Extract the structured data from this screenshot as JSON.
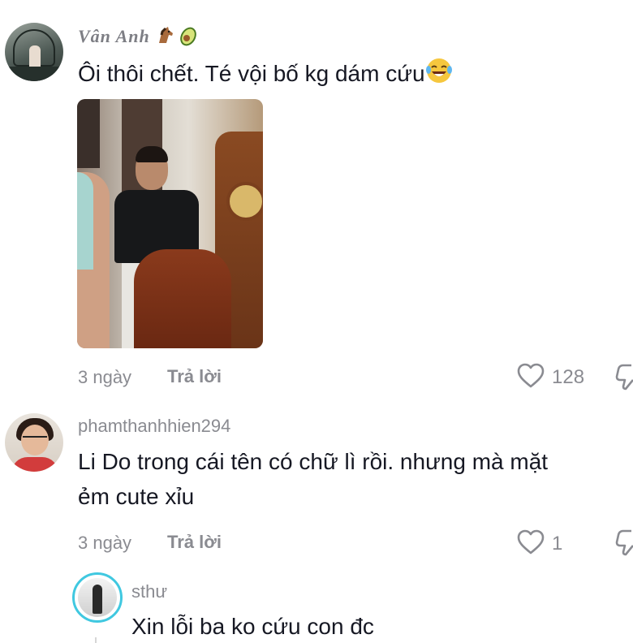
{
  "comments": [
    {
      "username": "Vân Anh",
      "username_emojis": [
        "horse-emoji",
        "avocado-emoji"
      ],
      "text": "Ôi thôi chết. Té vội bố kg dám cứu",
      "text_emoji": "laughing-tears-emoji",
      "has_photo": true,
      "time": "3 ngày",
      "reply_label": "Trả lời",
      "likes": "128"
    },
    {
      "username": "phamthanhhien294",
      "text_line1": "Li Do trong cái tên có chữ lì rồi. nhưng mà mặt",
      "text_line2": "ẻm cute xỉu",
      "time": "3 ngày",
      "reply_label": "Trả lời",
      "likes": "1"
    }
  ],
  "reply": {
    "username": "sthư",
    "text": "Xin lỗi ba ko cứu con đc"
  },
  "colors": {
    "text": "#161823",
    "muted": "#8a8b91",
    "reply_ring": "#40c8e0"
  },
  "icons": [
    "heart-outline-icon",
    "thumbs-down-icon"
  ]
}
